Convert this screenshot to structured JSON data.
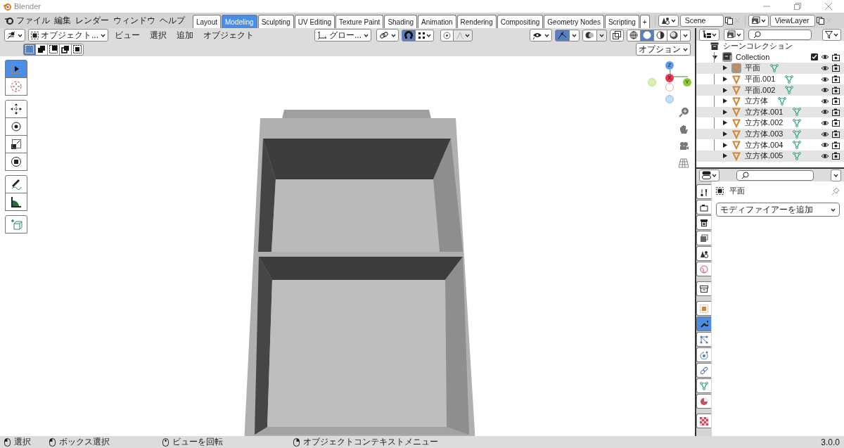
{
  "window": {
    "title": "Blender"
  },
  "menus": [
    "ファイル",
    "編集",
    "レンダー",
    "ウィンドウ",
    "ヘルプ"
  ],
  "workspace_tabs": [
    {
      "label": "Layout",
      "selected": false
    },
    {
      "label": "Modeling",
      "selected": true
    },
    {
      "label": "Sculpting",
      "selected": false
    },
    {
      "label": "UV Editing",
      "selected": false
    },
    {
      "label": "Texture Paint",
      "selected": false
    },
    {
      "label": "Shading",
      "selected": false
    },
    {
      "label": "Animation",
      "selected": false
    },
    {
      "label": "Rendering",
      "selected": false
    },
    {
      "label": "Compositing",
      "selected": false
    },
    {
      "label": "Geometry Nodes",
      "selected": false
    },
    {
      "label": "Scripting",
      "selected": false
    }
  ],
  "add_workspace": "+",
  "scene": "Scene",
  "view_layer": "ViewLayer",
  "viewport": {
    "mode": "オブジェクト...",
    "menus": [
      "ビュー",
      "選択",
      "追加",
      "オブジェクト"
    ],
    "orientation": "グロー...",
    "snap": {
      "on": true
    },
    "gizmos": {
      "on": true
    },
    "shading": [
      {
        "kind": "wireframe",
        "selected": false
      },
      {
        "kind": "solid",
        "selected": true
      },
      {
        "kind": "material",
        "selected": false
      },
      {
        "kind": "rendered",
        "selected": false
      }
    ],
    "select_modes": [
      {
        "selected": true
      },
      {
        "selected": false
      },
      {
        "selected": false
      },
      {
        "selected": false
      },
      {
        "selected": false
      }
    ],
    "options": "オプション",
    "tools": [
      {
        "kind": "select",
        "selected": true
      },
      {
        "kind": "cursor",
        "selected": false
      },
      {
        "kind": "move",
        "selected": false
      },
      {
        "kind": "rotate",
        "selected": false
      },
      {
        "kind": "scale",
        "selected": false
      },
      {
        "kind": "transform",
        "selected": false
      },
      {
        "kind": "annotate",
        "selected": false
      },
      {
        "kind": "measure",
        "selected": false
      },
      {
        "kind": "add_cube",
        "selected": false
      }
    ],
    "axes": [
      "Z",
      "X",
      "Y"
    ]
  },
  "outliner": {
    "title": "シーンコレクション",
    "collection": {
      "label": "Collection",
      "checked": true,
      "expanded": true
    },
    "objects": [
      {
        "label": "平面",
        "active": true
      },
      {
        "label": "平面.001",
        "active": false
      },
      {
        "label": "平面.002",
        "active": false
      },
      {
        "label": "立方体",
        "active": false
      },
      {
        "label": "立方体.001",
        "active": false
      },
      {
        "label": "立方体.002",
        "active": false
      },
      {
        "label": "立方体.003",
        "active": false
      },
      {
        "label": "立方体.004",
        "active": false
      },
      {
        "label": "立方体.005",
        "active": false
      }
    ]
  },
  "properties": {
    "object": "平面",
    "add_modifier": "モディファイアーを追加",
    "tabs": [
      {
        "kind": "tool",
        "selected": false
      },
      {
        "kind": "render",
        "selected": false
      },
      {
        "kind": "output",
        "selected": false
      },
      {
        "kind": "view_layer",
        "selected": false
      },
      {
        "kind": "scene",
        "selected": false
      },
      {
        "kind": "world",
        "selected": false
      },
      {
        "kind": "collection",
        "selected": false
      },
      {
        "kind": "object",
        "selected": false
      },
      {
        "kind": "modifier",
        "selected": true
      },
      {
        "kind": "particles",
        "selected": false
      },
      {
        "kind": "physics",
        "selected": false
      },
      {
        "kind": "constraints",
        "selected": false
      },
      {
        "kind": "data",
        "selected": false
      },
      {
        "kind": "material",
        "selected": false
      },
      {
        "kind": "texture",
        "selected": false
      }
    ]
  },
  "status_bar": {
    "hints": [
      {
        "kind": "left",
        "label": "選択"
      },
      {
        "kind": "left_drag",
        "label": "ボックス選択"
      },
      {
        "kind": "middle",
        "label": "ビューを回転"
      },
      {
        "kind": "right",
        "label": "オブジェクトコンテキストメニュー"
      }
    ],
    "version": "3.0.0"
  }
}
